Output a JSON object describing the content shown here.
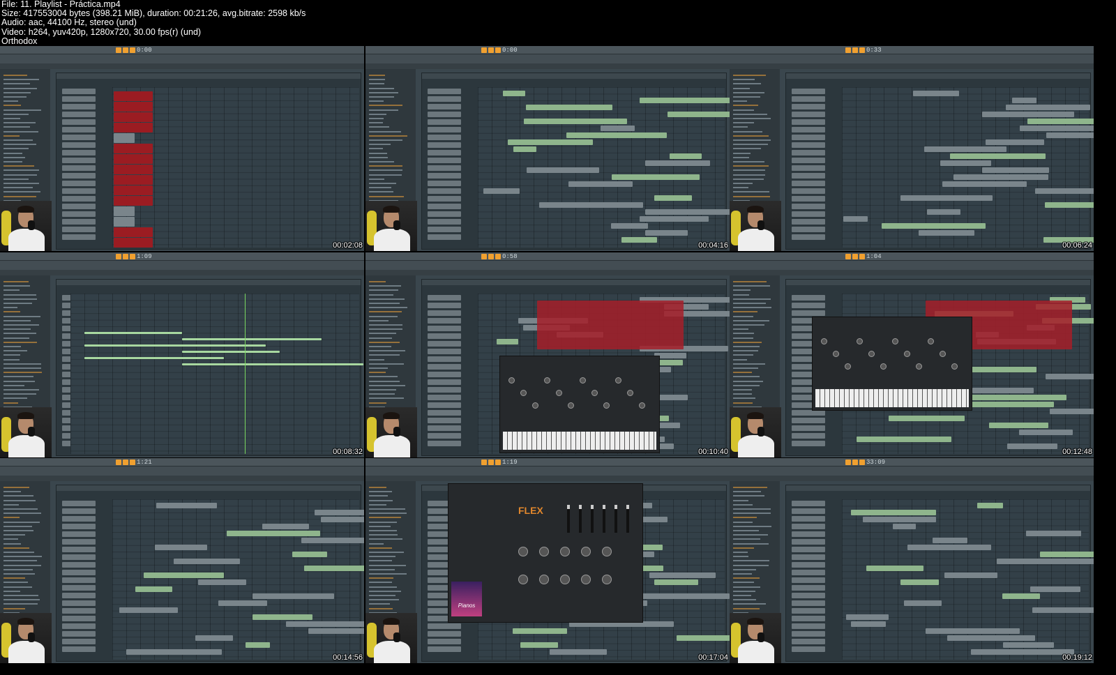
{
  "header": {
    "file": "File: 11. Playlist - Práctica.mp4",
    "size": "Size: 417553004 bytes (398.21 MiB), duration: 00:21:26, avg.bitrate: 2598 kb/s",
    "audio": "Audio: aac, 44100 Hz, stereo (und)",
    "video": "Video: h264, yuv420p, 1280x720, 30.00 fps(r) (und)",
    "author": "Orthodox"
  },
  "thumbnails": [
    {
      "timestamp": "00:02:08",
      "clock": "0:00"
    },
    {
      "timestamp": "00:04:16",
      "clock": "0:00"
    },
    {
      "timestamp": "00:06:24",
      "clock": "0:33"
    },
    {
      "timestamp": "00:08:32",
      "clock": "1:09"
    },
    {
      "timestamp": "00:10:40",
      "clock": "0:58"
    },
    {
      "timestamp": "00:12:48",
      "clock": "1:04"
    },
    {
      "timestamp": "00:14:56",
      "clock": "1:21"
    },
    {
      "timestamp": "00:17:04",
      "clock": "1:19",
      "plugin_name": "FLEX",
      "preset_art": "Pianos"
    },
    {
      "timestamp": "00:19:12",
      "clock": "33:09"
    }
  ],
  "colors": {
    "accent": "#f0a030",
    "red_clip": "#9b1c22",
    "grey_clip": "#7a858b",
    "green_note": "#a8d8a0"
  }
}
